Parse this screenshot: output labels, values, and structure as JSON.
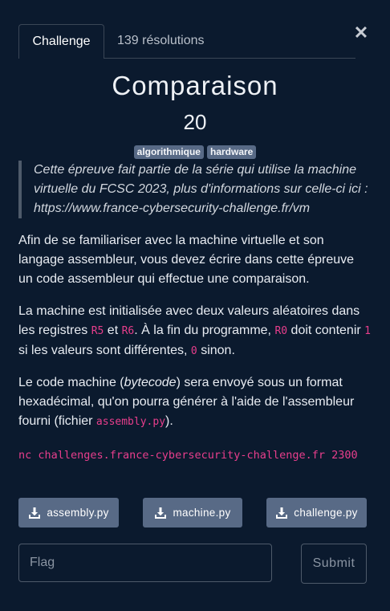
{
  "tabs": [
    {
      "label": "Challenge",
      "active": true
    },
    {
      "label": "139 résolutions",
      "active": false
    }
  ],
  "close_icon": "close-icon",
  "challenge": {
    "title": "Comparaison",
    "points": "20",
    "tags": [
      "algorithmique",
      "hardware"
    ]
  },
  "description": {
    "quote": "Cette épreuve fait partie de la série qui utilise la machine virtuelle du FCSC 2023, plus d'informations sur celle-ci ici : https://www.france-cybersecurity-challenge.fr/vm",
    "p1": "Afin de se familiariser avec la machine virtuelle et son langage assembleur, vous devez écrire dans cette épreuve un code assembleur qui effectue une comparaison.",
    "p2": {
      "t1": "La machine est initialisée avec deux valeurs aléatoires dans les registres ",
      "c1": "R5",
      "t2": " et ",
      "c2": "R6",
      "t3": ". À la fin du programme, ",
      "c3": "R0",
      "t4": " doit contenir ",
      "c4": "1",
      "t5": " si les valeurs sont différentes, ",
      "c5": "0",
      "t6": " sinon."
    },
    "p3": {
      "t1": "Le code machine (",
      "em": "bytecode",
      "t2": ") sera envoyé sous un format hexadécimal, qu'on pourra générer à l'aide de l'assembleur fourni (fichier ",
      "c1": "assembly.py",
      "t3": ")."
    },
    "command": "nc challenges.france-cybersecurity-challenge.fr 2300"
  },
  "files": [
    {
      "label": "assembly.py",
      "icon": "download-icon"
    },
    {
      "label": "machine.py",
      "icon": "download-icon"
    },
    {
      "label": "challenge.py",
      "icon": "download-icon"
    }
  ],
  "form": {
    "flag_value": "",
    "flag_placeholder": "Flag",
    "submit_label": "Submit"
  },
  "colors": {
    "background": "#0b1a2e",
    "tag": "#586a86",
    "code": "#e83e8c"
  }
}
